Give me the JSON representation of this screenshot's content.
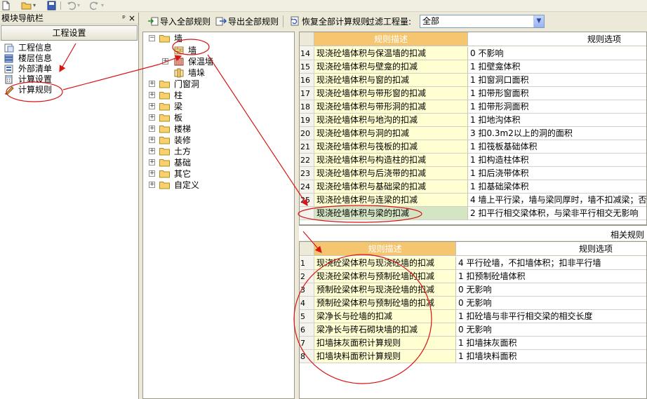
{
  "navigator": {
    "title": "模块导航栏",
    "pin": "ᵖ",
    "close": "×",
    "section_button": "工程设置",
    "items": [
      {
        "label": "工程信息",
        "icon": "document-icon"
      },
      {
        "label": "楼层信息",
        "icon": "floors-icon"
      },
      {
        "label": "外部清单",
        "icon": "list-icon"
      },
      {
        "label": "计算设置",
        "icon": "calc-icon"
      },
      {
        "label": "计算规则",
        "icon": "ruler-icon"
      }
    ]
  },
  "toolbar": {
    "import_label": "导入全部规则",
    "export_label": "导出全部规则",
    "restore_label": "恢复全部计算规则",
    "filter_label": "过滤工程量:",
    "filter_value": "全部"
  },
  "tree": {
    "root_label": "墙",
    "children": [
      "墙",
      "保温墙",
      "墙垛"
    ],
    "groups": [
      "门窗洞",
      "柱",
      "梁",
      "板",
      "楼梯",
      "装修",
      "土方",
      "基础",
      "其它",
      "自定义"
    ]
  },
  "rules_grid": {
    "col_desc": "规则描述",
    "col_option": "规则选项",
    "rows": [
      {
        "num": "14",
        "desc": "现浇砼墙体积与保温墙的扣减",
        "option": "0  不影响"
      },
      {
        "num": "15",
        "desc": "现浇砼墙体积与壁龛的扣减",
        "option": "1  扣壁龛体积"
      },
      {
        "num": "16",
        "desc": "现浇砼墙体积与窗的扣减",
        "option": "1  扣窗洞口面积"
      },
      {
        "num": "17",
        "desc": "现浇砼墙体积与带形窗的扣减",
        "option": "1  扣带形窗面积"
      },
      {
        "num": "18",
        "desc": "现浇砼墙体积与带形洞的扣减",
        "option": "1  扣带形洞面积"
      },
      {
        "num": "19",
        "desc": "现浇砼墙体积与地沟的扣减",
        "option": "1  扣地沟体积"
      },
      {
        "num": "20",
        "desc": "现浇砼墙体积与洞的扣减",
        "option": "3  扣0.3m2以上的洞的面积"
      },
      {
        "num": "21",
        "desc": "现浇砼墙体积与筏板的扣减",
        "option": "1  扣筏板基础体积"
      },
      {
        "num": "22",
        "desc": "现浇砼墙体积与构造柱的扣减",
        "option": "1  扣构造柱体积"
      },
      {
        "num": "23",
        "desc": "现浇砼墙体积与后浇带的扣减",
        "option": "1   扣后浇带体积"
      },
      {
        "num": "24",
        "desc": "现浇砼墙体积与基础梁的扣减",
        "option": "1  扣基础梁体积"
      },
      {
        "num": "25",
        "desc": "现浇砼墙体积与连梁的扣减",
        "option": "4  墙上平行梁，墙与梁同厚时，墙不扣减梁；否"
      },
      {
        "num": "",
        "desc": "现浇砼墙体积与梁的扣减",
        "option": "2  扣平行相交梁体积，与梁非平行相交无影响"
      }
    ]
  },
  "related": {
    "title": "相关规则",
    "col_desc": "规则描述",
    "col_option": "规则选项",
    "rows": [
      {
        "num": "1",
        "desc": "现浇砼梁体积与现浇砼墙的扣减",
        "option": "4 平行砼墙，不扣墙体积；扣非平行墙"
      },
      {
        "num": "2",
        "desc": "现浇砼梁体积与预制砼墙的扣减",
        "option": "1  扣预制砼墙体积"
      },
      {
        "num": "3",
        "desc": "预制砼梁体积与现浇砼墙的扣减",
        "option": "0  无影响"
      },
      {
        "num": "4",
        "desc": "预制砼梁体积与预制砼墙的扣减",
        "option": "0  无影响"
      },
      {
        "num": "5",
        "desc": "梁净长与砼墙的扣减",
        "option": "1 扣砼墙与非平行相交梁的相交长度"
      },
      {
        "num": "6",
        "desc": "梁净长与砖石砌块墙的扣减",
        "option": "0  无影响"
      },
      {
        "num": "7",
        "desc": "扣墙抹灰面积计算规则",
        "option": "1 扣墙抹灰面积"
      },
      {
        "num": "8",
        "desc": "扣墙块料面积计算规则",
        "option": "1 扣墙块料面积"
      }
    ]
  },
  "colors": {
    "header_orange": "#f5c66f",
    "desc_yellow": "#ffffd2",
    "selection_green": "#d4e5c4",
    "annotation_red": "#d81414"
  }
}
